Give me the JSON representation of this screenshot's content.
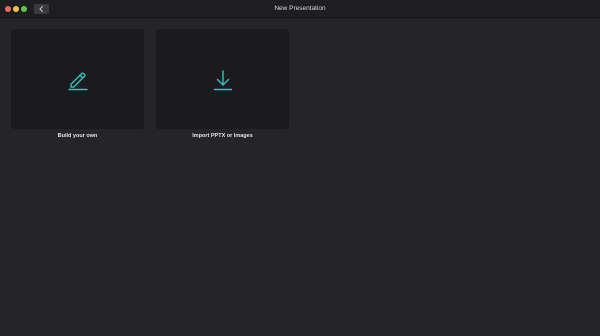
{
  "window": {
    "title": "New Presentation"
  },
  "toolbar": {
    "back_icon": "chevron-left-icon"
  },
  "options": [
    {
      "label": "Build your own",
      "icon": "pencil-icon"
    },
    {
      "label": "Import PPTX or Images",
      "icon": "download-arrow-icon"
    }
  ],
  "colors": {
    "accent": "#2cc3bf",
    "background": "#252528",
    "card": "#1b1b1d",
    "titlebar": "#1e1e21"
  }
}
